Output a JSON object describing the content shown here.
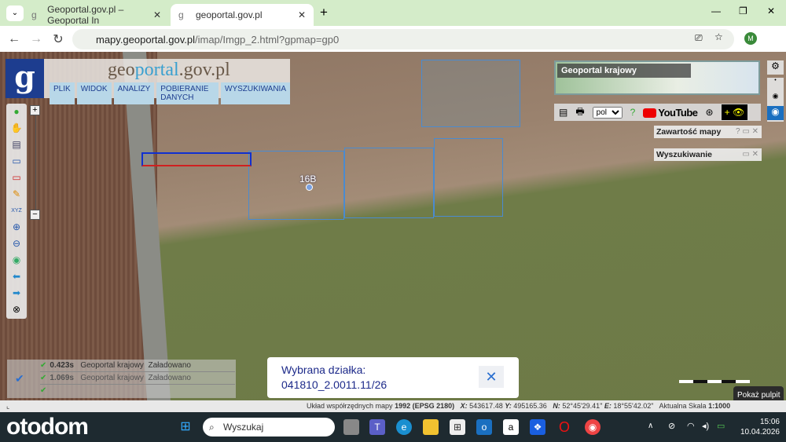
{
  "browser": {
    "tabs": [
      {
        "label": "Geoportal.gov.pl – Geoportal In",
        "active": false
      },
      {
        "label": "geoportal.gov.pl",
        "active": true
      }
    ],
    "url_host": "mapy.geoportal.gov.pl",
    "url_path": "/imap/Imgp_2.html?gpmap=gp0",
    "profile": "M"
  },
  "app": {
    "logo_letter": "g",
    "title_pre": "geo",
    "title_mid": "portal",
    "title_post": ".gov.pl",
    "menu": [
      "PLIK",
      "WIDOK",
      "ANALIZY",
      "POBIERANIE DANYCH",
      "WYSZUKIWANIA"
    ],
    "minimap_label": "Geoportal krajowy",
    "language": "pol",
    "youtube": "YouTube",
    "panels": {
      "content": "Zawartość mapy",
      "search": "Wyszukiwanie"
    },
    "map_label": "16B",
    "status_rows": [
      {
        "time": "0.423s",
        "source": "Geoportal krajowy",
        "state": "Załadowano"
      },
      {
        "time": "1.069s",
        "source": "Geoportal krajowy",
        "state": "Załadowano"
      }
    ],
    "popup": {
      "title": "Wybrana działka:",
      "value": "041810_2.0011.11/26"
    },
    "tooltip": "Pokaż pulpit",
    "coords": {
      "system_label": "Układ współrzędnych mapy",
      "system": "1992 (EPSG 2180)",
      "x": "543617.48",
      "y": "495165.36",
      "n": "52°45'29.41\"",
      "e": "18°55'42.02\"",
      "scale_label": "Aktualna Skala",
      "scale": "1:1000"
    }
  },
  "taskbar": {
    "brand": "otodom",
    "search_placeholder": "Wyszukaj",
    "time": "15:06",
    "date": "10.04.2026"
  }
}
